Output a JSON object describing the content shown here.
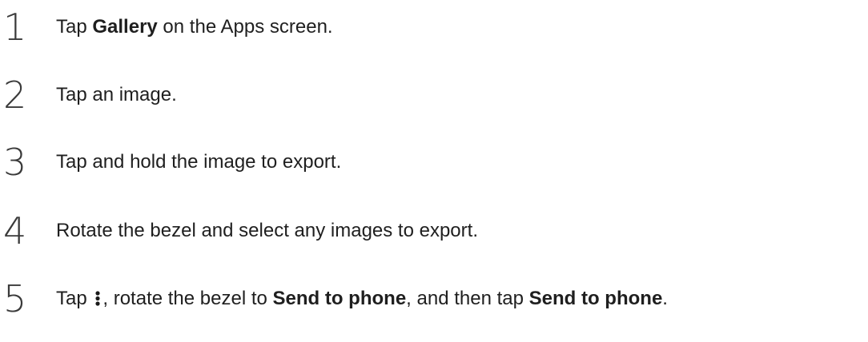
{
  "steps": [
    {
      "number": "1",
      "parts": {
        "before": "Tap ",
        "bold1": "Gallery",
        "after": " on the Apps screen."
      }
    },
    {
      "number": "2",
      "text": "Tap an image."
    },
    {
      "number": "3",
      "text": "Tap and hold the image to export."
    },
    {
      "number": "4",
      "text": "Rotate the bezel and select any images to export."
    },
    {
      "number": "5",
      "parts": {
        "before": "Tap ",
        "icon": "more-options-icon",
        "middle1": ", rotate the bezel to ",
        "bold1": "Send to phone",
        "middle2": ", and then tap ",
        "bold2": "Send to phone",
        "after": "."
      }
    }
  ]
}
